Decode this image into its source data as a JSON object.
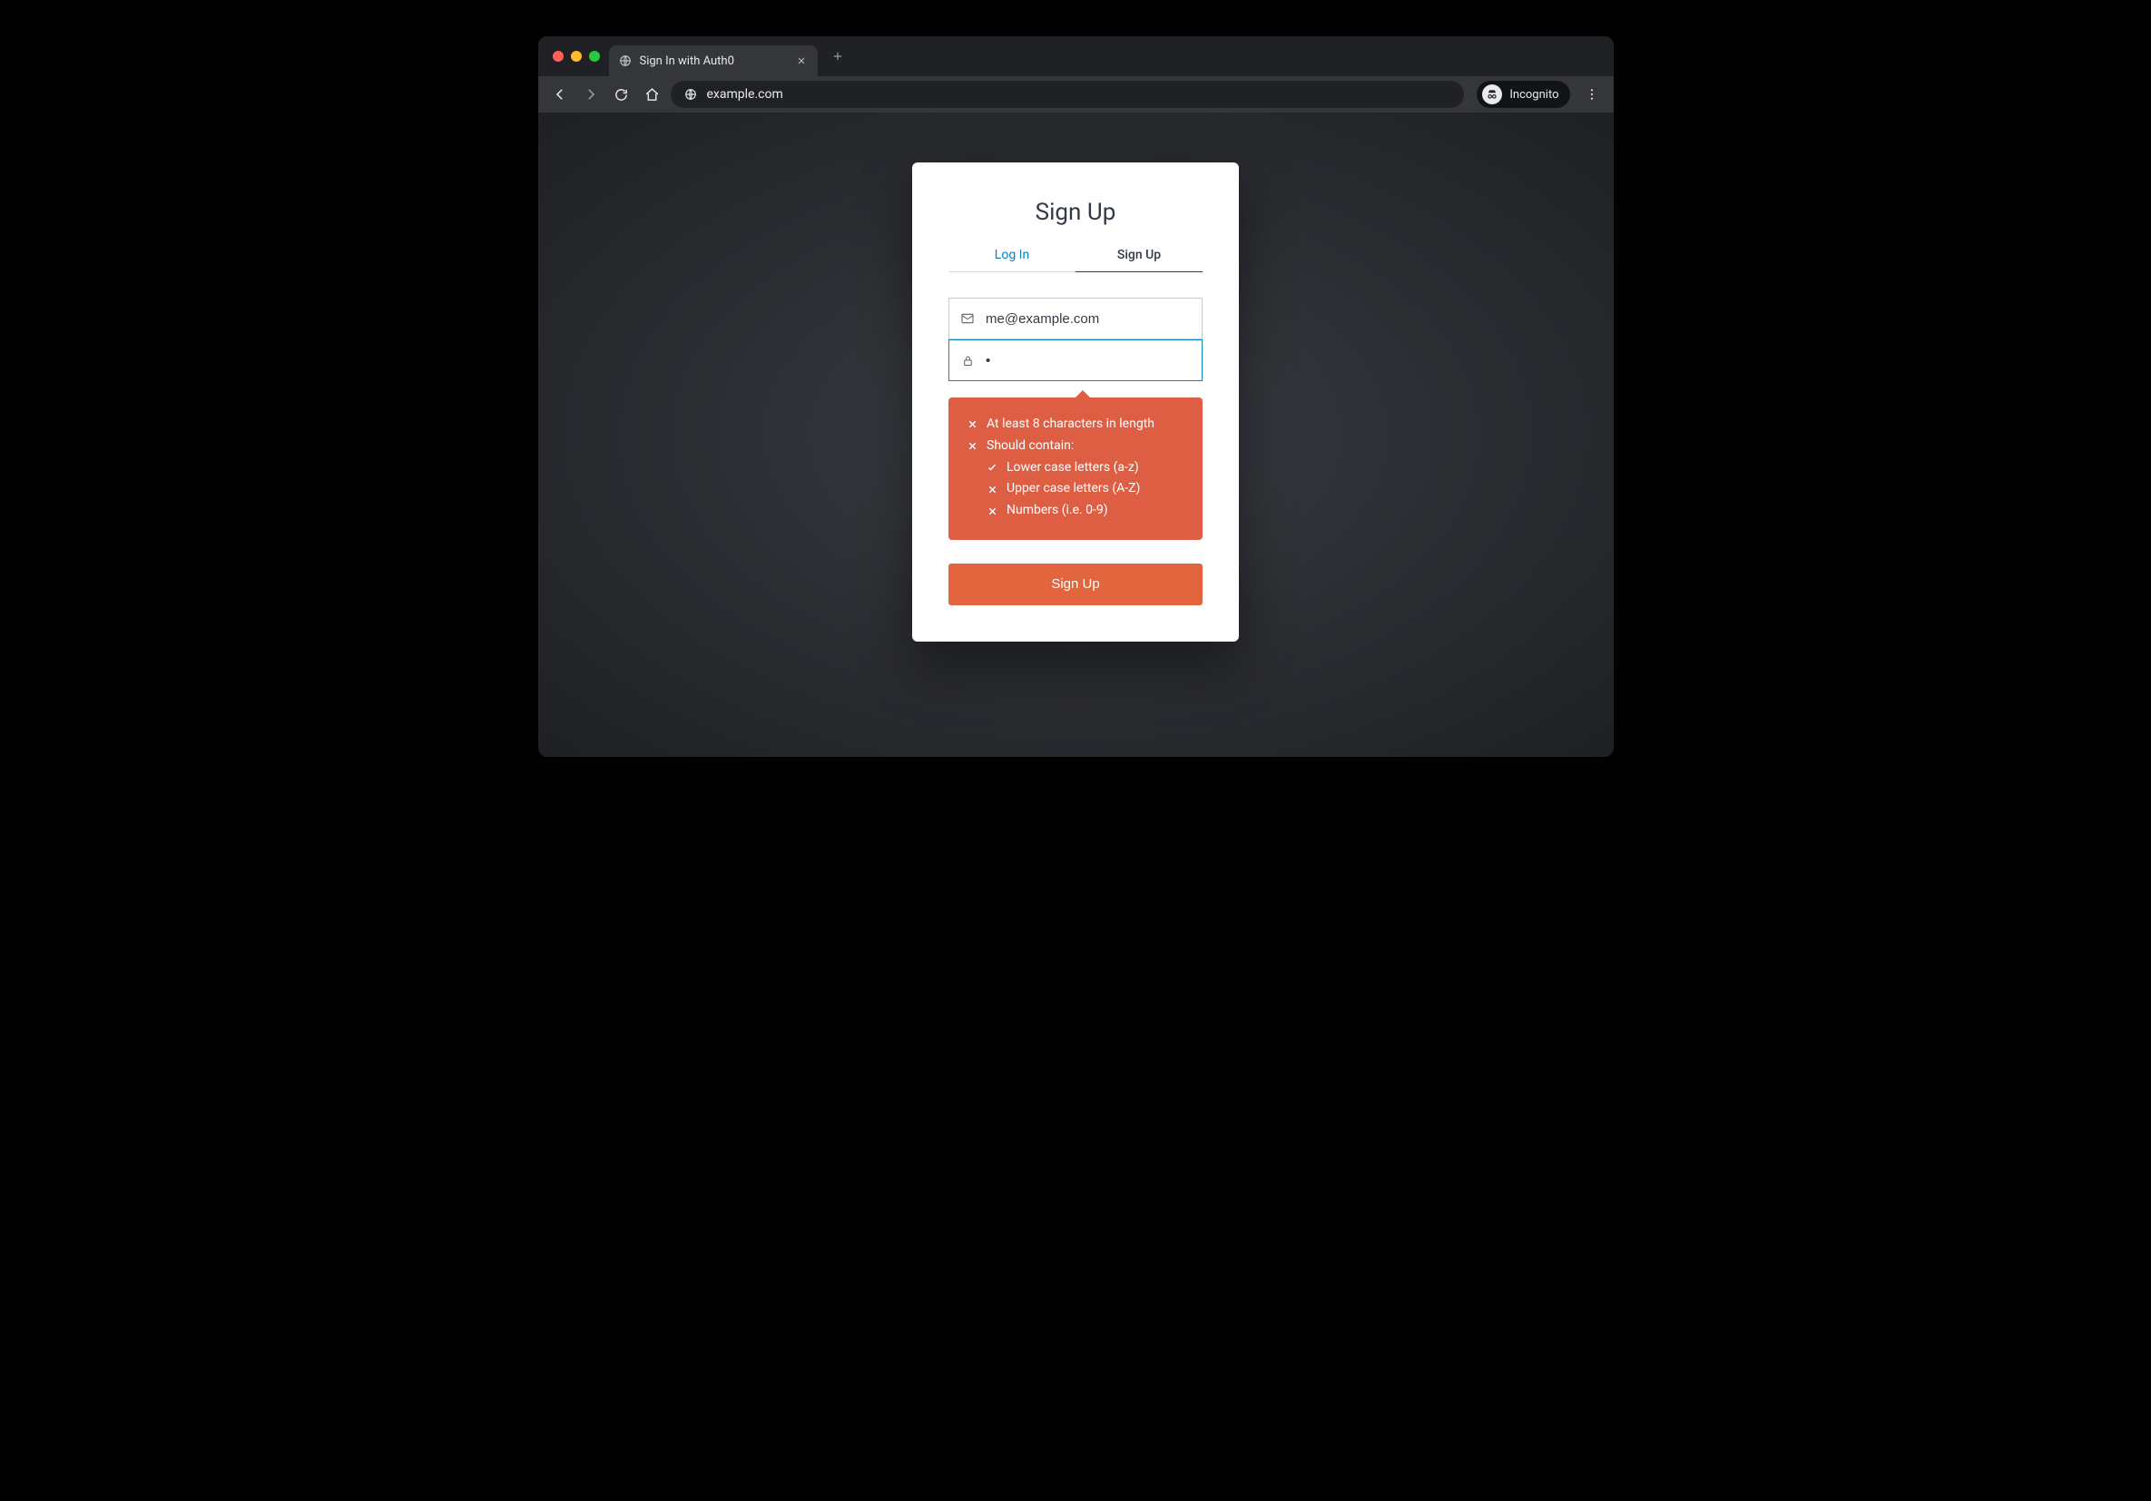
{
  "browser": {
    "tab_title": "Sign In with Auth0",
    "url": "example.com",
    "incognito_label": "Incognito"
  },
  "auth": {
    "heading": "Sign Up",
    "tabs": {
      "login": "Log In",
      "signup": "Sign Up"
    },
    "email_value": "me@example.com",
    "password_value": "•",
    "password_rules": {
      "length": "At least 8 characters in length",
      "contain_heading": "Should contain:",
      "lower": "Lower case letters (a-z)",
      "upper": "Upper case letters (A-Z)",
      "numbers": "Numbers (i.e. 0-9)"
    },
    "submit_label": "Sign Up"
  }
}
